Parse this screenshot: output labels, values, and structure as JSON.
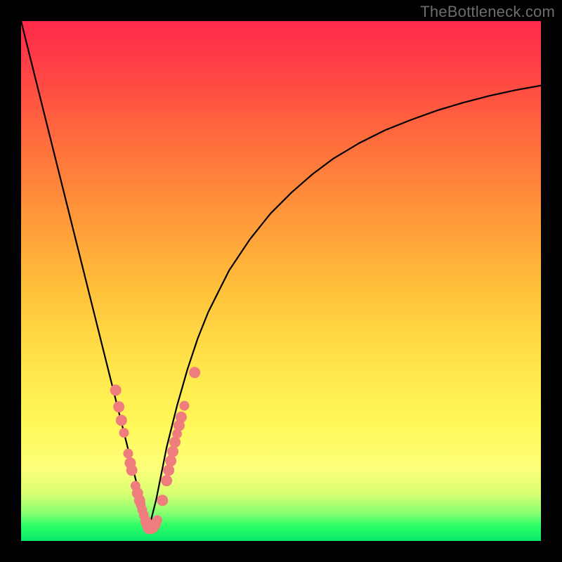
{
  "watermark": "TheBottleneck.com",
  "chart_data": {
    "type": "line",
    "title": "",
    "xlabel": "",
    "ylabel": "",
    "xlim": [
      0,
      100
    ],
    "ylim": [
      0,
      100
    ],
    "optimum_x": 24.5,
    "series": [
      {
        "name": "bottleneck-curve",
        "x": [
          0,
          2,
          4,
          6,
          8,
          10,
          12,
          14,
          16,
          18,
          19,
          20,
          21,
          22,
          23,
          24,
          24.5,
          25,
          26,
          27,
          28,
          29,
          30,
          32,
          34,
          36,
          38,
          40,
          44,
          48,
          52,
          56,
          60,
          65,
          70,
          75,
          80,
          85,
          90,
          95,
          100
        ],
        "y": [
          100,
          92,
          84,
          76,
          68,
          60,
          52,
          44,
          36,
          28,
          24,
          20,
          16,
          12,
          8,
          4,
          2,
          4,
          8,
          13,
          18,
          22,
          26,
          33,
          39,
          44,
          48,
          52,
          58,
          63,
          67,
          70.5,
          73.5,
          76.5,
          79,
          81,
          82.8,
          84.3,
          85.6,
          86.7,
          87.6
        ]
      }
    ],
    "markers": {
      "name": "sample-points",
      "color": "#ef7d7d",
      "points": [
        {
          "x": 18.2,
          "y": 29.0,
          "r": 8
        },
        {
          "x": 18.8,
          "y": 25.8,
          "r": 8
        },
        {
          "x": 19.3,
          "y": 23.2,
          "r": 8
        },
        {
          "x": 19.8,
          "y": 20.8,
          "r": 7
        },
        {
          "x": 20.6,
          "y": 16.8,
          "r": 7
        },
        {
          "x": 21.0,
          "y": 15.0,
          "r": 8
        },
        {
          "x": 21.3,
          "y": 13.6,
          "r": 8
        },
        {
          "x": 22.0,
          "y": 10.6,
          "r": 7
        },
        {
          "x": 22.4,
          "y": 9.2,
          "r": 8
        },
        {
          "x": 22.8,
          "y": 7.8,
          "r": 8
        },
        {
          "x": 23.0,
          "y": 7.0,
          "r": 7
        },
        {
          "x": 23.3,
          "y": 6.0,
          "r": 7
        },
        {
          "x": 23.6,
          "y": 5.0,
          "r": 7
        },
        {
          "x": 24.0,
          "y": 3.8,
          "r": 8
        },
        {
          "x": 24.3,
          "y": 3.0,
          "r": 8
        },
        {
          "x": 24.6,
          "y": 2.4,
          "r": 8
        },
        {
          "x": 25.0,
          "y": 2.4,
          "r": 8
        },
        {
          "x": 25.4,
          "y": 2.6,
          "r": 8
        },
        {
          "x": 25.8,
          "y": 3.2,
          "r": 8
        },
        {
          "x": 26.2,
          "y": 4.0,
          "r": 7
        },
        {
          "x": 27.2,
          "y": 7.8,
          "r": 8
        },
        {
          "x": 28.0,
          "y": 11.6,
          "r": 8
        },
        {
          "x": 28.4,
          "y": 13.6,
          "r": 8
        },
        {
          "x": 28.8,
          "y": 15.4,
          "r": 8
        },
        {
          "x": 29.2,
          "y": 17.2,
          "r": 8
        },
        {
          "x": 29.6,
          "y": 19.0,
          "r": 8
        },
        {
          "x": 30.0,
          "y": 20.6,
          "r": 7
        },
        {
          "x": 30.4,
          "y": 22.2,
          "r": 8
        },
        {
          "x": 30.8,
          "y": 23.8,
          "r": 8
        },
        {
          "x": 31.4,
          "y": 26.0,
          "r": 7
        },
        {
          "x": 33.4,
          "y": 32.4,
          "r": 8
        }
      ]
    },
    "gradient_stops": [
      {
        "pos": 0.0,
        "color": "#ff2a4a"
      },
      {
        "pos": 0.08,
        "color": "#ff3e46"
      },
      {
        "pos": 0.22,
        "color": "#ff6a3d"
      },
      {
        "pos": 0.36,
        "color": "#ff933a"
      },
      {
        "pos": 0.52,
        "color": "#ffc23a"
      },
      {
        "pos": 0.66,
        "color": "#ffe44a"
      },
      {
        "pos": 0.78,
        "color": "#fff95a"
      },
      {
        "pos": 0.86,
        "color": "#fdff7a"
      },
      {
        "pos": 0.91,
        "color": "#d8ff72"
      },
      {
        "pos": 0.95,
        "color": "#7dff70"
      },
      {
        "pos": 0.97,
        "color": "#2fff66"
      },
      {
        "pos": 1.0,
        "color": "#06e869"
      }
    ]
  }
}
